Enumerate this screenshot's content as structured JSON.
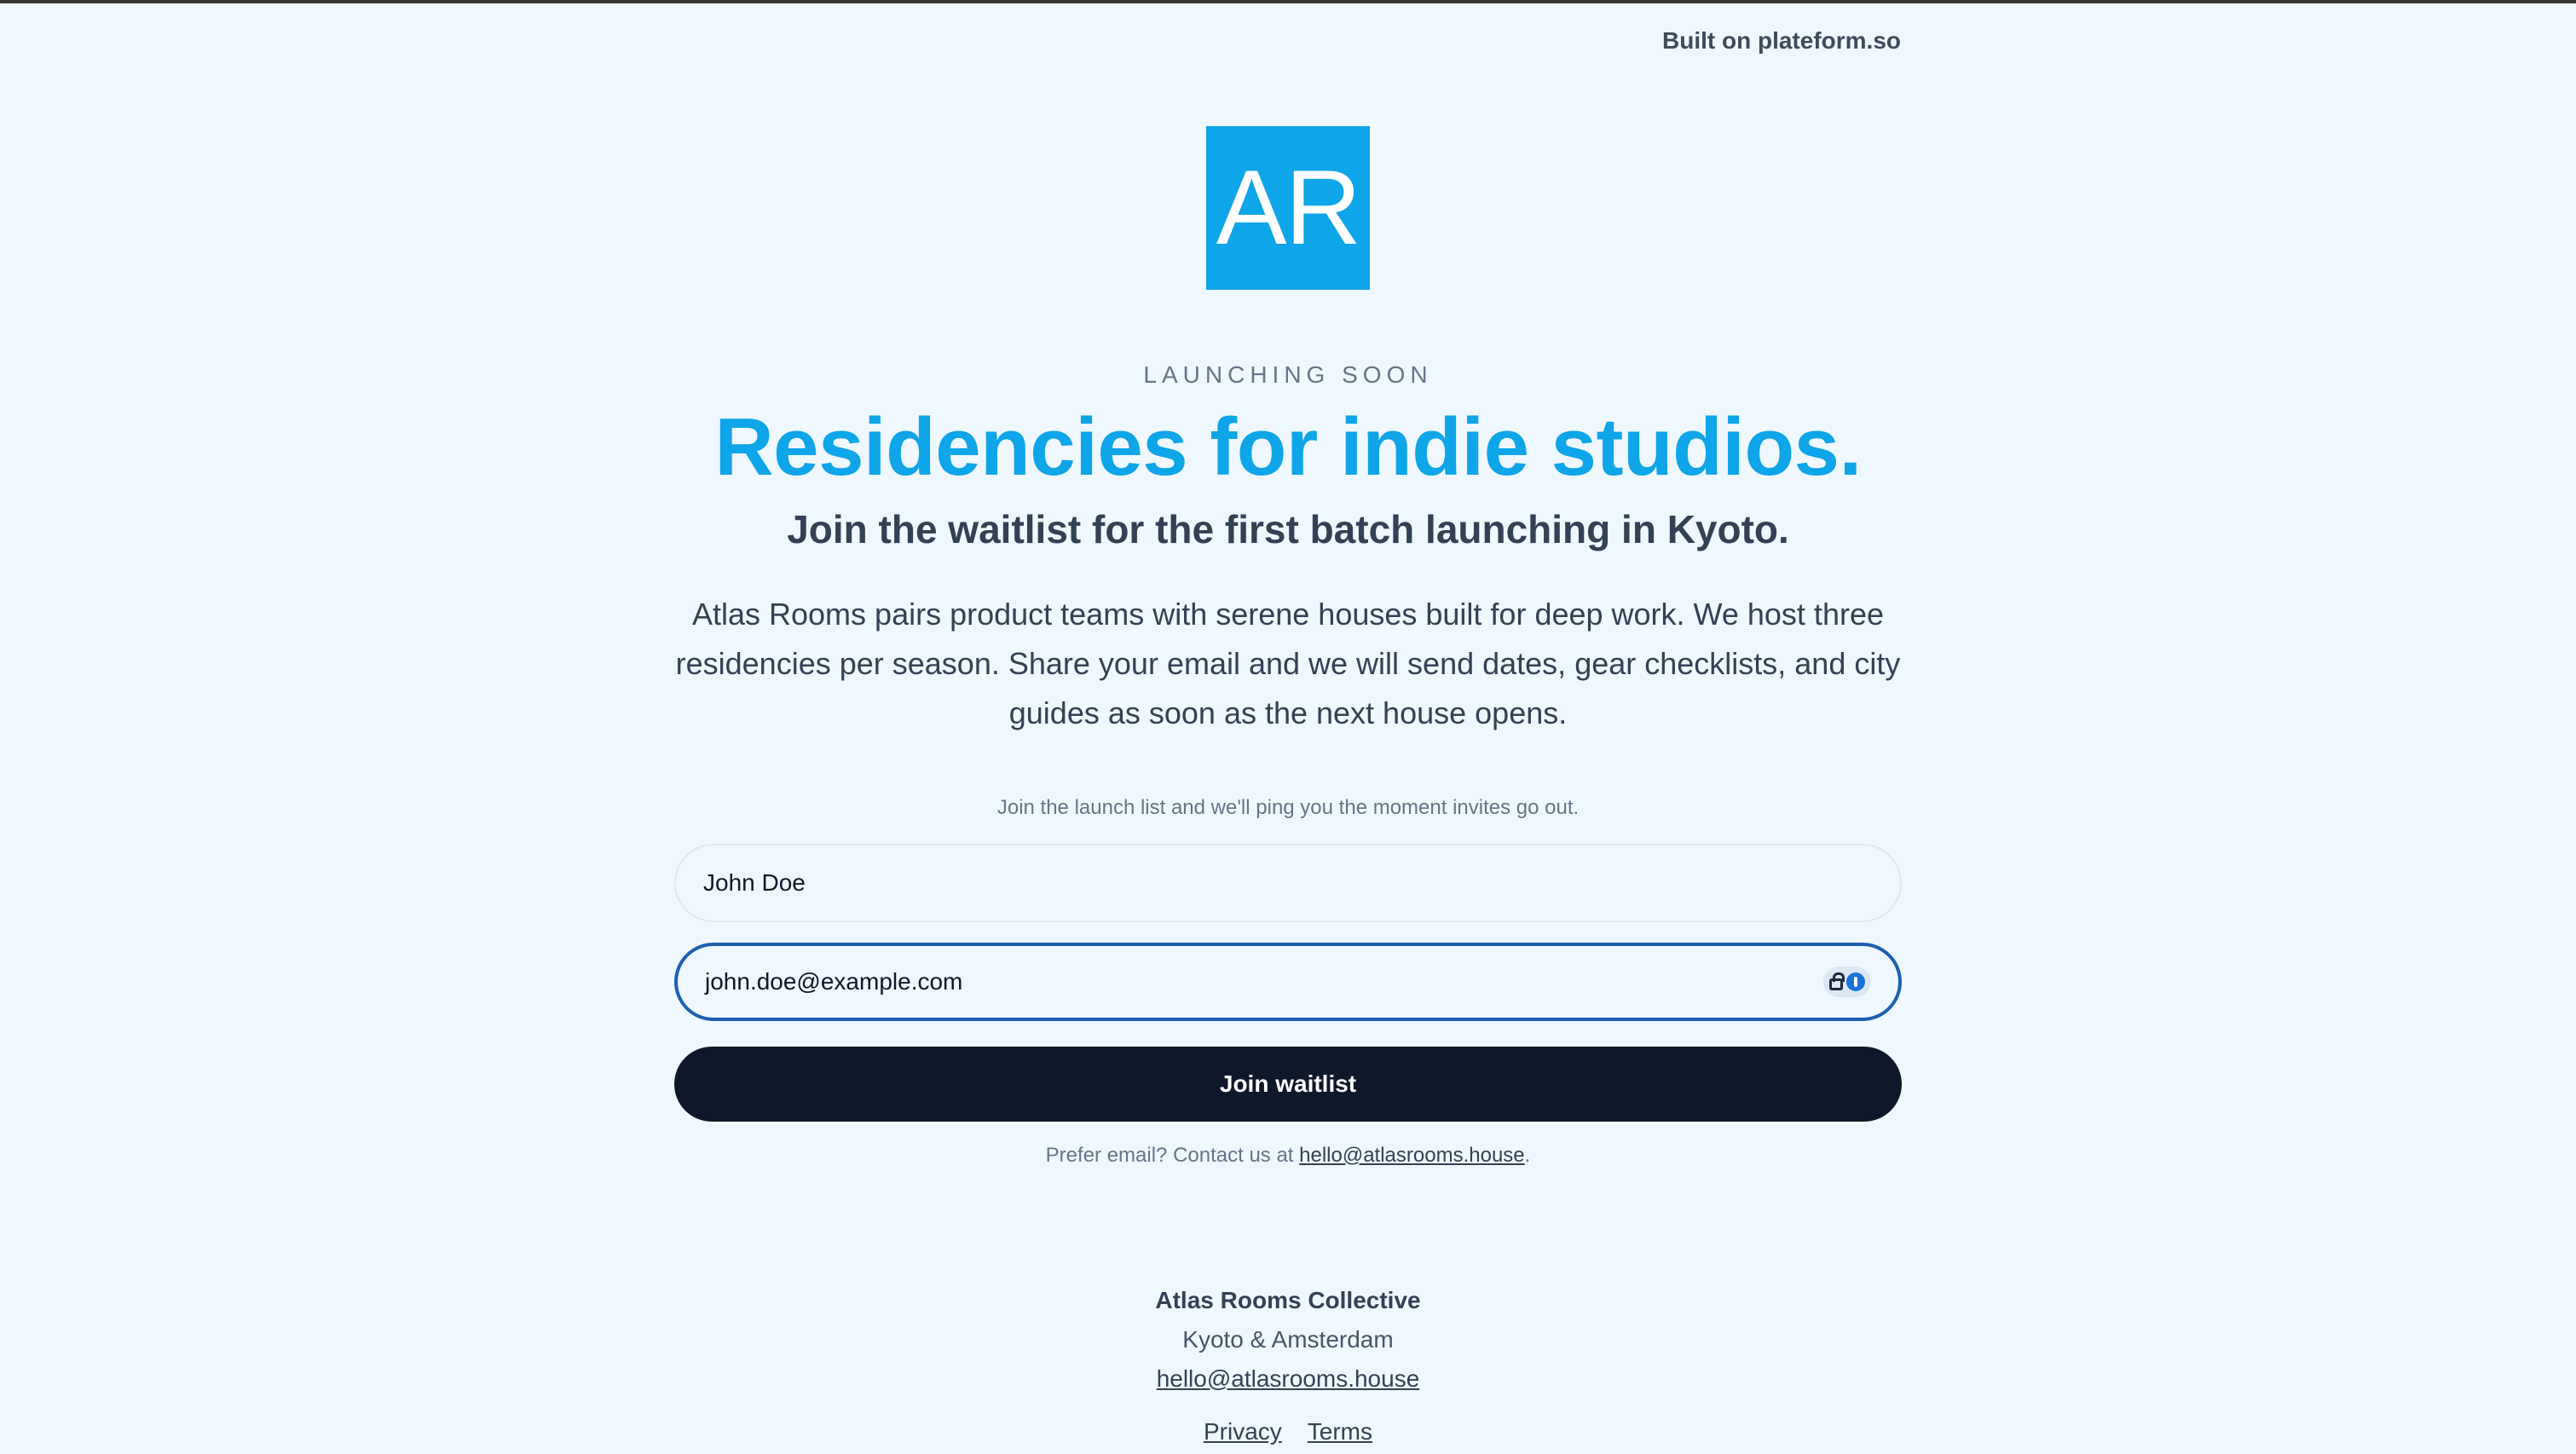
{
  "header": {
    "built_on": "Built on plateform.so"
  },
  "logo": {
    "text": "AR",
    "color": "#0ea5e9"
  },
  "hero": {
    "eyebrow": "LAUNCHING SOON",
    "headline": "Residencies for indie studios.",
    "subhead": "Join the waitlist for the first batch launching in Kyoto.",
    "description": "Atlas Rooms pairs product teams with serene houses built for deep work. We host three residencies per season. Share your email and we will send dates, gear checklists, and city guides as soon as the next house opens."
  },
  "form": {
    "note": "Join the launch list and we'll ping you the moment invites go out.",
    "name_value": "John Doe",
    "email_value": "john.doe@example.com",
    "submit_label": "Join waitlist",
    "password_manager_icon": "password-manager-icon"
  },
  "contact": {
    "prefix": "Prefer email? Contact us at ",
    "email": "hello@atlasrooms.house",
    "suffix": "."
  },
  "footer": {
    "name": "Atlas Rooms Collective",
    "location": "Kyoto & Amsterdam",
    "email": "hello@atlasrooms.house",
    "links": [
      "Privacy",
      "Terms"
    ]
  },
  "colors": {
    "background": "#eff8ff",
    "accent": "#0ea5e9",
    "button": "#0f172a",
    "focus_border": "#1d5fb0"
  }
}
